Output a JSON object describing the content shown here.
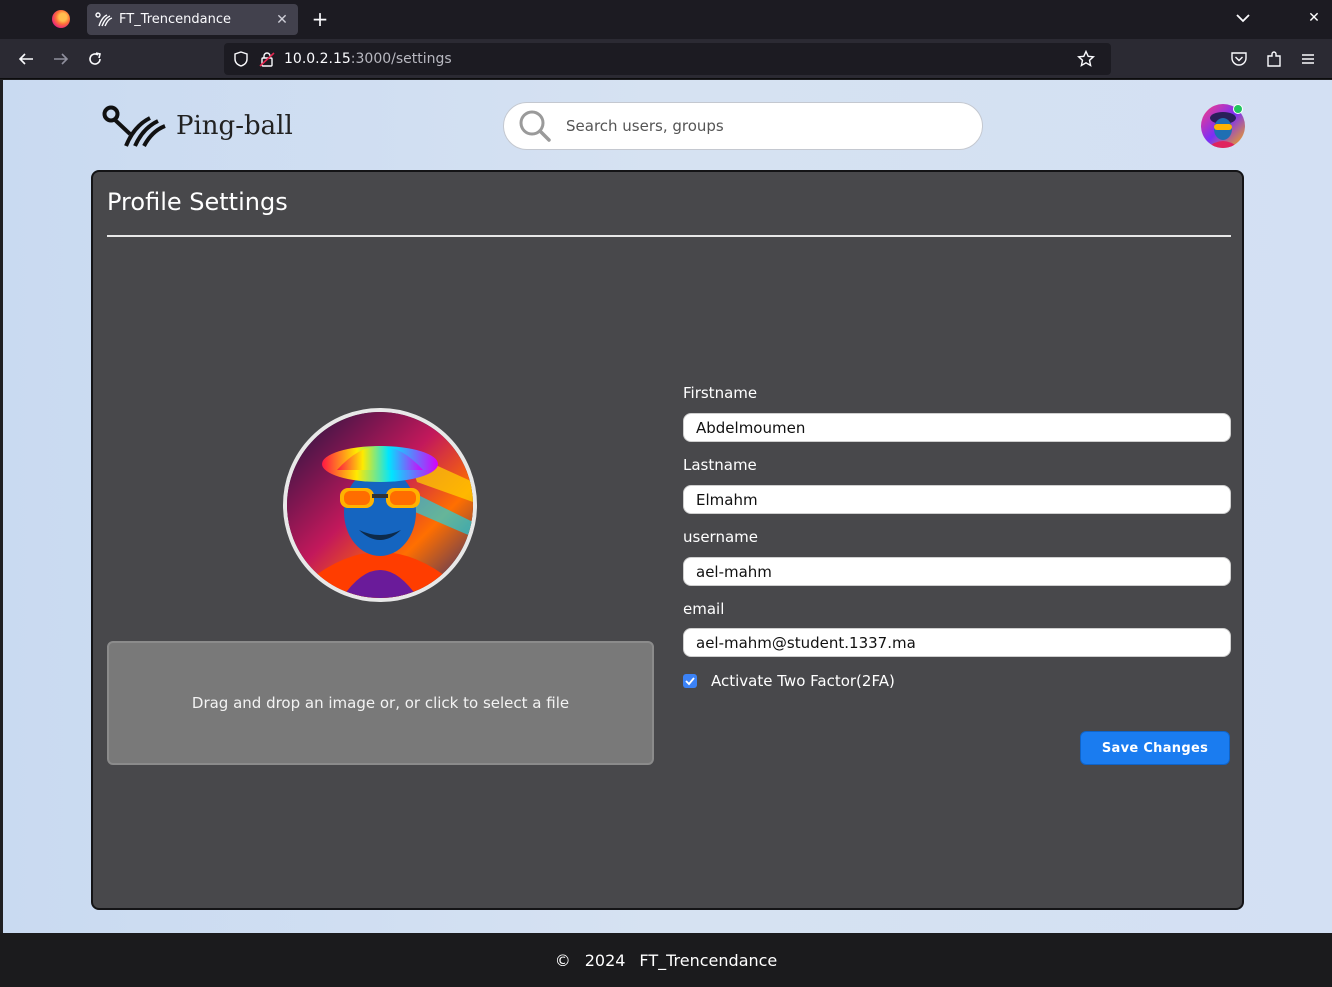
{
  "browser": {
    "tab_title": "FT_Trencendance",
    "new_tab_label": "+",
    "url_host": "10.0.2.15",
    "url_path": ":3000/settings"
  },
  "header": {
    "brand": "Ping-ball",
    "search_placeholder": "Search users, groups"
  },
  "settings": {
    "title": "Profile Settings",
    "dropzone_text": "Drag and drop an image or, or click to select a file",
    "fields": [
      {
        "label": "Firstname",
        "value": "Abdelmoumen"
      },
      {
        "label": "Lastname",
        "value": "Elmahm"
      },
      {
        "label": "username",
        "value": "ael-mahm"
      },
      {
        "label": "email",
        "value": "ael-mahm@student.1337.ma"
      }
    ],
    "twofa_label": "Activate Two Factor(2FA)",
    "twofa_checked": true,
    "save_label": "Save Changes"
  },
  "footer": {
    "copyright": "©",
    "year": "2024",
    "name": "FT_Trencendance"
  },
  "colors": {
    "accent": "#1a7cf0",
    "online": "#22c55e",
    "card_bg": "#48484b"
  },
  "icons": [
    "firefox-icon",
    "tab-favicon-icon",
    "close-icon",
    "chevron-down-icon",
    "back-icon",
    "forward-icon",
    "reload-icon",
    "shield-icon",
    "lock-icon",
    "star-icon",
    "pocket-icon",
    "extensions-icon",
    "menu-icon",
    "search-icon",
    "avatar",
    "checkbox-check-icon"
  ]
}
